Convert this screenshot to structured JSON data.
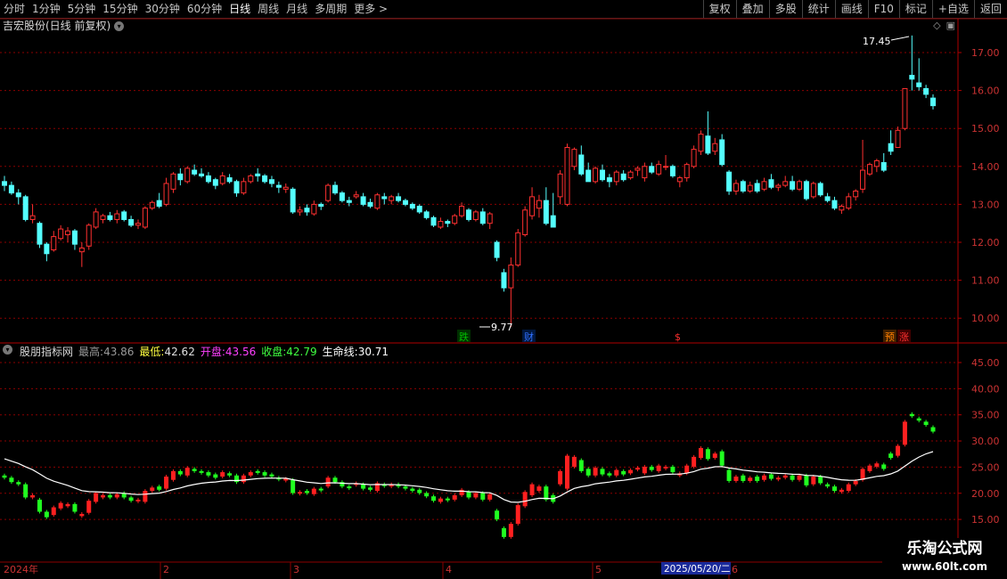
{
  "toolbar": {
    "tabs": [
      "分时",
      "1分钟",
      "5分钟",
      "15分钟",
      "30分钟",
      "60分钟",
      "日线",
      "周线",
      "月线",
      "多周期",
      "更多 >"
    ],
    "active_tab": "日线",
    "tools": [
      "复权",
      "叠加",
      "多股",
      "统计",
      "画线",
      "F10",
      "标记",
      "+自选",
      "返回"
    ]
  },
  "main_panel": {
    "title": "吉宏股份(日线 前复权)",
    "price_axis": [
      "17.00",
      "16.00",
      "15.00",
      "14.00",
      "13.00",
      "12.00",
      "11.00",
      "10.00"
    ],
    "high_label": "17.45",
    "low_label": "9.77",
    "signals": [
      {
        "text": "跌",
        "color": "#00c000"
      },
      {
        "text": "财",
        "color": "#3070ff"
      },
      {
        "text": "$",
        "color": "#ff3030"
      },
      {
        "text": "预",
        "color": "#ff8000"
      },
      {
        "text": "涨",
        "color": "#ff3030"
      }
    ]
  },
  "indicator_panel": {
    "name": "股朋指标网",
    "high_label": "最高:",
    "high_value": "43.86",
    "low_label": "最低:",
    "low_value": "42.62",
    "open_label": "开盘:",
    "open_value": "43.56",
    "close_label": "收盘:",
    "close_value": "42.79",
    "life_label": "生命线:",
    "life_value": "30.71",
    "axis": [
      "45.00",
      "40.00",
      "35.00",
      "30.00",
      "25.00",
      "20.00",
      "15.00"
    ]
  },
  "date_axis": {
    "year": "2024年",
    "months": [
      "2",
      "3",
      "4",
      "5",
      "6"
    ],
    "cursor_date": "2025/05/20/二"
  },
  "watermark": {
    "line1": "乐淘公式网",
    "line2": "www.60lt.com"
  },
  "colors": {
    "up": "#ff3030",
    "down": "#54ffff",
    "ind_up": "#ff2020",
    "ind_down": "#20ff20",
    "life_line": "#ffffff",
    "grid": "#8b0000"
  },
  "chart_data": {
    "type": "candlestick",
    "ohlc": [
      [
        13.6,
        13.75,
        13.35,
        13.5
      ],
      [
        13.5,
        13.6,
        13.25,
        13.3
      ],
      [
        13.3,
        13.4,
        13.0,
        13.2
      ],
      [
        13.2,
        13.25,
        12.55,
        12.6
      ],
      [
        12.6,
        13.0,
        12.5,
        12.7
      ],
      [
        12.5,
        12.55,
        11.85,
        11.95
      ],
      [
        11.95,
        12.0,
        11.5,
        11.7
      ],
      [
        11.8,
        12.3,
        11.75,
        12.15
      ],
      [
        12.1,
        12.45,
        12.05,
        12.35
      ],
      [
        12.2,
        12.4,
        12.0,
        12.3
      ],
      [
        12.3,
        12.35,
        11.8,
        11.95
      ],
      [
        11.75,
        12.0,
        11.35,
        11.85
      ],
      [
        11.9,
        12.5,
        11.8,
        12.45
      ],
      [
        12.4,
        12.9,
        12.35,
        12.8
      ],
      [
        12.6,
        12.75,
        12.5,
        12.7
      ],
      [
        12.7,
        12.8,
        12.55,
        12.6
      ],
      [
        12.6,
        12.85,
        12.5,
        12.75
      ],
      [
        12.8,
        12.85,
        12.55,
        12.6
      ],
      [
        12.6,
        12.7,
        12.4,
        12.45
      ],
      [
        12.45,
        12.6,
        12.35,
        12.5
      ],
      [
        12.4,
        12.95,
        12.35,
        12.9
      ],
      [
        12.9,
        13.1,
        12.85,
        13.05
      ],
      [
        13.1,
        13.3,
        12.9,
        12.95
      ],
      [
        13.0,
        13.7,
        12.95,
        13.55
      ],
      [
        13.4,
        13.85,
        13.3,
        13.8
      ],
      [
        13.8,
        13.95,
        13.5,
        13.65
      ],
      [
        13.6,
        14.0,
        13.55,
        13.95
      ],
      [
        13.9,
        14.05,
        13.75,
        13.8
      ],
      [
        13.8,
        13.95,
        13.7,
        13.75
      ],
      [
        13.75,
        13.85,
        13.55,
        13.6
      ],
      [
        13.65,
        13.7,
        13.4,
        13.5
      ],
      [
        13.55,
        13.85,
        13.5,
        13.75
      ],
      [
        13.7,
        13.8,
        13.55,
        13.6
      ],
      [
        13.6,
        13.65,
        13.2,
        13.3
      ],
      [
        13.3,
        13.7,
        13.25,
        13.6
      ],
      [
        13.6,
        13.8,
        13.55,
        13.75
      ],
      [
        13.8,
        13.95,
        13.6,
        13.75
      ],
      [
        13.75,
        13.8,
        13.55,
        13.6
      ],
      [
        13.65,
        13.75,
        13.45,
        13.55
      ],
      [
        13.5,
        13.6,
        13.3,
        13.45
      ],
      [
        13.4,
        13.55,
        13.3,
        13.45
      ],
      [
        13.4,
        13.45,
        12.75,
        12.8
      ],
      [
        12.8,
        12.95,
        12.7,
        12.85
      ],
      [
        12.9,
        13.0,
        12.7,
        12.8
      ],
      [
        12.75,
        13.1,
        12.7,
        13.0
      ],
      [
        13.0,
        13.05,
        12.85,
        12.95
      ],
      [
        13.1,
        13.55,
        13.05,
        13.5
      ],
      [
        13.5,
        13.6,
        13.25,
        13.3
      ],
      [
        13.3,
        13.35,
        13.05,
        13.1
      ],
      [
        13.1,
        13.2,
        12.95,
        13.05
      ],
      [
        13.2,
        13.35,
        13.15,
        13.25
      ],
      [
        13.2,
        13.3,
        12.95,
        13.0
      ],
      [
        13.05,
        13.15,
        12.9,
        12.95
      ],
      [
        12.9,
        13.3,
        12.85,
        13.25
      ],
      [
        13.2,
        13.3,
        13.0,
        13.15
      ],
      [
        13.1,
        13.25,
        13.0,
        13.2
      ],
      [
        13.2,
        13.3,
        13.05,
        13.1
      ],
      [
        13.1,
        13.15,
        12.95,
        13.0
      ],
      [
        13.0,
        13.05,
        12.85,
        12.9
      ],
      [
        12.95,
        13.0,
        12.75,
        12.8
      ],
      [
        12.8,
        12.85,
        12.6,
        12.65
      ],
      [
        12.65,
        12.7,
        12.4,
        12.45
      ],
      [
        12.4,
        12.65,
        12.35,
        12.55
      ],
      [
        12.55,
        12.6,
        12.4,
        12.5
      ],
      [
        12.5,
        12.75,
        12.45,
        12.7
      ],
      [
        12.7,
        13.05,
        12.65,
        12.95
      ],
      [
        12.85,
        12.9,
        12.55,
        12.6
      ],
      [
        12.6,
        12.85,
        12.55,
        12.8
      ],
      [
        12.8,
        12.9,
        12.45,
        12.5
      ],
      [
        12.5,
        12.8,
        12.35,
        12.75
      ],
      [
        12.0,
        12.05,
        11.5,
        11.6
      ],
      [
        11.2,
        11.3,
        10.7,
        10.8
      ],
      [
        10.8,
        11.6,
        9.77,
        11.4
      ],
      [
        11.4,
        12.35,
        11.35,
        12.25
      ],
      [
        12.2,
        12.95,
        12.15,
        12.85
      ],
      [
        12.7,
        13.45,
        12.6,
        13.2
      ],
      [
        12.9,
        13.25,
        12.65,
        13.1
      ],
      [
        13.1,
        13.45,
        12.45,
        12.5
      ],
      [
        12.7,
        13.3,
        12.4,
        12.4
      ],
      [
        13.2,
        13.9,
        13.0,
        13.8
      ],
      [
        13.0,
        14.6,
        12.95,
        14.5
      ],
      [
        14.0,
        14.5,
        13.9,
        14.45
      ],
      [
        14.3,
        14.55,
        13.75,
        13.8
      ],
      [
        13.9,
        14.1,
        13.6,
        13.6
      ],
      [
        13.6,
        14.0,
        13.55,
        13.95
      ],
      [
        13.9,
        14.05,
        13.6,
        13.65
      ],
      [
        13.7,
        13.8,
        13.45,
        13.6
      ],
      [
        13.6,
        13.9,
        13.5,
        13.85
      ],
      [
        13.8,
        13.9,
        13.6,
        13.65
      ],
      [
        13.7,
        13.9,
        13.65,
        13.85
      ],
      [
        13.9,
        14.0,
        13.75,
        13.95
      ],
      [
        13.7,
        14.1,
        13.6,
        14.0
      ],
      [
        14.0,
        14.1,
        13.8,
        13.85
      ],
      [
        13.8,
        14.15,
        13.75,
        14.05
      ],
      [
        14.0,
        14.3,
        13.9,
        14.0
      ],
      [
        14.0,
        14.05,
        13.7,
        13.75
      ],
      [
        13.6,
        13.75,
        13.45,
        13.7
      ],
      [
        13.7,
        14.1,
        13.6,
        14.05
      ],
      [
        14.0,
        14.55,
        13.95,
        14.45
      ],
      [
        14.4,
        14.95,
        14.3,
        14.85
      ],
      [
        14.8,
        15.45,
        14.3,
        14.35
      ],
      [
        14.4,
        14.75,
        14.3,
        14.6
      ],
      [
        14.7,
        14.85,
        14.0,
        14.05
      ],
      [
        13.85,
        13.9,
        13.25,
        13.35
      ],
      [
        13.35,
        13.65,
        13.25,
        13.55
      ],
      [
        13.6,
        13.65,
        13.3,
        13.35
      ],
      [
        13.35,
        13.6,
        13.3,
        13.5
      ],
      [
        13.55,
        13.65,
        13.3,
        13.35
      ],
      [
        13.4,
        13.7,
        13.35,
        13.6
      ],
      [
        13.65,
        13.8,
        13.4,
        13.45
      ],
      [
        13.45,
        13.55,
        13.35,
        13.5
      ],
      [
        13.5,
        13.75,
        13.45,
        13.6
      ],
      [
        13.6,
        13.75,
        13.35,
        13.4
      ],
      [
        13.4,
        13.65,
        13.35,
        13.6
      ],
      [
        13.6,
        13.65,
        13.1,
        13.15
      ],
      [
        13.2,
        13.6,
        13.15,
        13.55
      ],
      [
        13.55,
        13.6,
        13.2,
        13.25
      ],
      [
        13.2,
        13.3,
        13.05,
        13.1
      ],
      [
        13.1,
        13.2,
        12.85,
        12.9
      ],
      [
        12.85,
        13.0,
        12.75,
        12.95
      ],
      [
        12.9,
        13.3,
        12.85,
        13.2
      ],
      [
        13.2,
        13.4,
        13.1,
        13.35
      ],
      [
        13.4,
        14.7,
        13.3,
        13.9
      ],
      [
        13.8,
        14.1,
        13.75,
        14.05
      ],
      [
        14.0,
        14.2,
        13.85,
        14.15
      ],
      [
        14.1,
        14.35,
        13.85,
        13.9
      ],
      [
        14.6,
        14.95,
        14.3,
        14.4
      ],
      [
        14.5,
        15.05,
        14.5,
        14.95
      ],
      [
        15.0,
        16.0,
        14.95,
        16.05
      ],
      [
        16.4,
        17.45,
        16.0,
        16.3
      ],
      [
        16.2,
        16.85,
        16.0,
        16.1
      ],
      [
        16.05,
        16.15,
        15.8,
        15.9
      ],
      [
        15.8,
        15.9,
        15.5,
        15.6
      ]
    ],
    "life_line_axis": [
      15,
      45
    ]
  }
}
